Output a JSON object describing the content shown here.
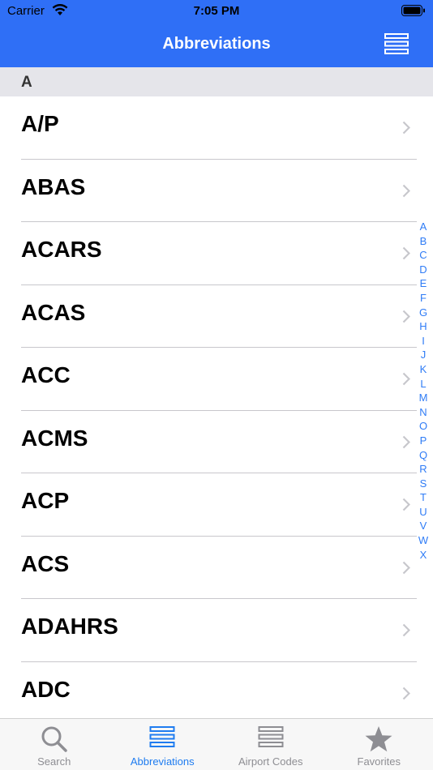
{
  "status": {
    "carrier": "Carrier",
    "time": "7:05 PM"
  },
  "nav": {
    "title": "Abbreviations"
  },
  "section": {
    "letter": "A"
  },
  "rows": [
    "A/P",
    "ABAS",
    "ACARS",
    "ACAS",
    "ACC",
    "ACMS",
    "ACP",
    "ACS",
    "ADAHRS",
    "ADC"
  ],
  "index": [
    "A",
    "B",
    "C",
    "D",
    "E",
    "F",
    "G",
    "H",
    "I",
    "J",
    "K",
    "L",
    "M",
    "N",
    "O",
    "P",
    "Q",
    "R",
    "S",
    "T",
    "U",
    "V",
    "W",
    "X"
  ],
  "tabs": [
    {
      "label": "Search",
      "icon": "search-icon"
    },
    {
      "label": "Abbreviations",
      "icon": "list-icon",
      "active": true
    },
    {
      "label": "Airport Codes",
      "icon": "list-icon"
    },
    {
      "label": "Favorites",
      "icon": "star-icon"
    }
  ],
  "colors": {
    "accent": "#2f6ff6",
    "active_tab": "#1f7cf0",
    "inactive_tab": "#8e8e93"
  }
}
